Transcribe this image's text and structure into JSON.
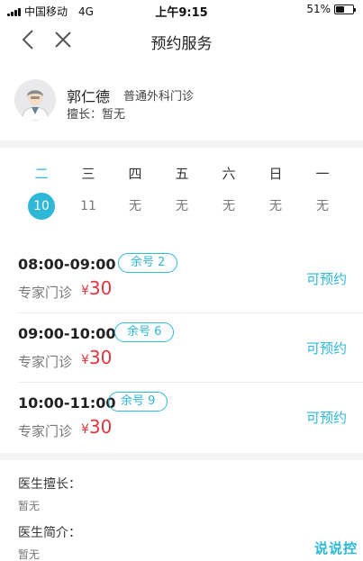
{
  "status_bar": {
    "carrier": "中国移动",
    "network": "4G",
    "time": "上午9:15",
    "battery": "51%",
    "battery_level": 0.51
  },
  "nav": {
    "title": "预约服务",
    "back_icon": "chevron-left-icon",
    "close_icon": "close-icon"
  },
  "doctor": {
    "name": "郭仁德",
    "department": "普通外科门诊",
    "specialty": "擅长：暂无"
  },
  "week": {
    "days": [
      "二",
      "三",
      "四",
      "五",
      "六",
      "日",
      "一"
    ],
    "dates": [
      "10",
      "11",
      "无",
      "无",
      "无",
      "无",
      "无"
    ],
    "selected_index": 0
  },
  "slots": [
    {
      "time": "08:00-09:00",
      "remaining": "余号 2",
      "type": "专家门诊",
      "currency": "¥",
      "price": "30",
      "action": "可预约"
    },
    {
      "time": "09:00-10:00",
      "remaining": "余号 6",
      "type": "专家门诊",
      "currency": "¥",
      "price": "30",
      "action": "可预约"
    },
    {
      "time": "10:00-11:00",
      "remaining": "余号 9",
      "type": "专家门诊",
      "currency": "¥",
      "price": "30",
      "action": "可预约"
    }
  ],
  "info": {
    "specialty_label": "医生擅长：",
    "specialty_value": "暂无",
    "intro_label": "医生简介：",
    "intro_value": "暂无"
  },
  "watermark": "说说控",
  "colors": {
    "accent": "#2eb7d7",
    "price": "#e0363f",
    "divider": "#f3f3f5"
  }
}
